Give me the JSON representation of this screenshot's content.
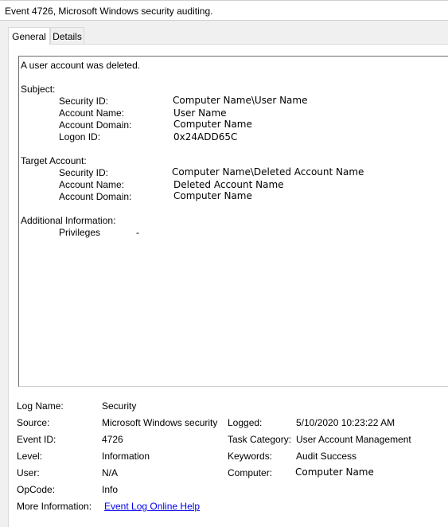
{
  "window": {
    "title": "Event 4726, Microsoft Windows security auditing."
  },
  "tabs": [
    {
      "label": "General"
    },
    {
      "label": "Details"
    }
  ],
  "description": {
    "headline": "A user account was deleted.",
    "subject": {
      "heading": "Subject:",
      "security_id_label": "Security ID:",
      "security_id": "Computer Name\\User Name",
      "account_name_label": "Account Name:",
      "account_name": "User Name",
      "account_domain_label": "Account Domain:",
      "account_domain": "Computer Name",
      "logon_id_label": "Logon ID:",
      "logon_id": "0x24ADD65C"
    },
    "target": {
      "heading": "Target Account:",
      "security_id_label": "Security ID:",
      "security_id": "Computer Name\\Deleted Account Name",
      "account_name_label": "Account Name:",
      "account_name": "Deleted Account Name",
      "account_domain_label": "Account Domain:",
      "account_domain": "Computer Name"
    },
    "additional": {
      "heading": "Additional Information:",
      "privileges_label": "Privileges",
      "privileges": "-"
    }
  },
  "details": {
    "log_name_label": "Log Name:",
    "log_name": "Security",
    "source_label": "Source:",
    "source": "Microsoft Windows security",
    "logged_label": "Logged:",
    "logged": "5/10/2020 10:23:22 AM",
    "event_id_label": "Event ID:",
    "event_id": "4726",
    "task_category_label": "Task Category:",
    "task_category": "User Account Management",
    "level_label": "Level:",
    "level": "Information",
    "keywords_label": "Keywords:",
    "keywords": "Audit Success",
    "user_label": "User:",
    "user": "N/A",
    "computer_label": "Computer:",
    "computer": "Computer Name",
    "opcode_label": "OpCode:",
    "opcode": "Info",
    "more_info_label": "More Information:",
    "more_info_link": "Event Log Online Help"
  }
}
